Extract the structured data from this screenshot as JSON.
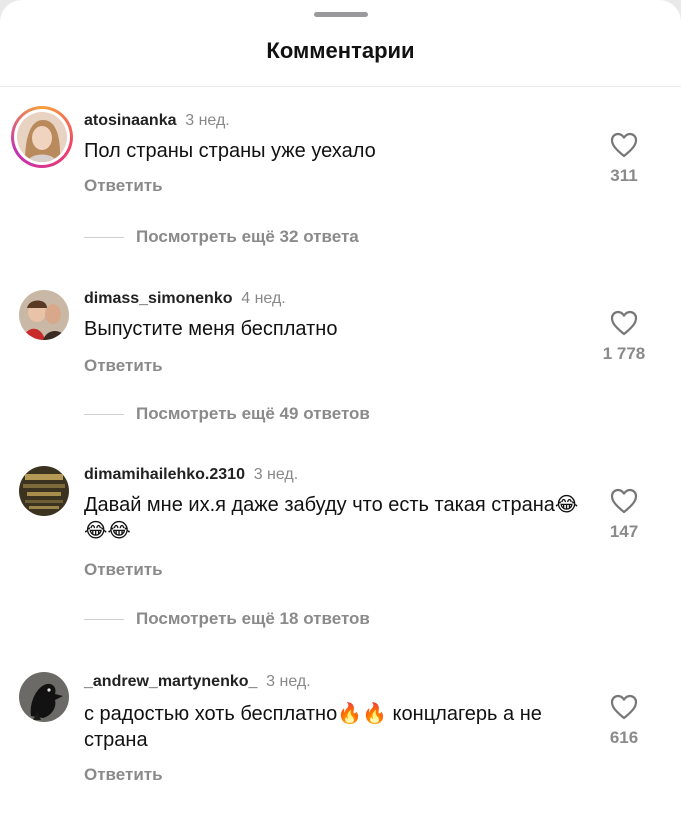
{
  "header": {
    "title": "Комментарии"
  },
  "comments": [
    {
      "username": "atosinaanka",
      "time": "3 нед.",
      "text": "Пол страны страны уже уехало",
      "reply": "Ответить",
      "likes": "311",
      "more_replies": "Посмотреть ещё 32 ответа",
      "has_story": true
    },
    {
      "username": "dimass_simonenko",
      "time": "4 нед.",
      "text": "Выпустите меня бесплатно",
      "reply": "Ответить",
      "likes": "1 778",
      "more_replies": "Посмотреть ещё 49 ответов"
    },
    {
      "username": "dimamihailehko.2310",
      "time": "3 нед.",
      "text": "Давай мне их.я даже забуду что есть такая страна😂😂😂",
      "reply": "Ответить",
      "likes": "147",
      "more_replies": "Посмотреть ещё 18 ответов"
    },
    {
      "username": "_andrew_martynenko_",
      "time": "3 нед.",
      "text": "с радостью хоть бесплатно🔥🔥 концлагерь а не страна",
      "reply": "Ответить",
      "likes": "616"
    }
  ],
  "icons": {
    "like": "heart-outline-icon"
  },
  "colors": {
    "muted": "#8a8a8a",
    "story_ring": "#ee3b6d"
  }
}
